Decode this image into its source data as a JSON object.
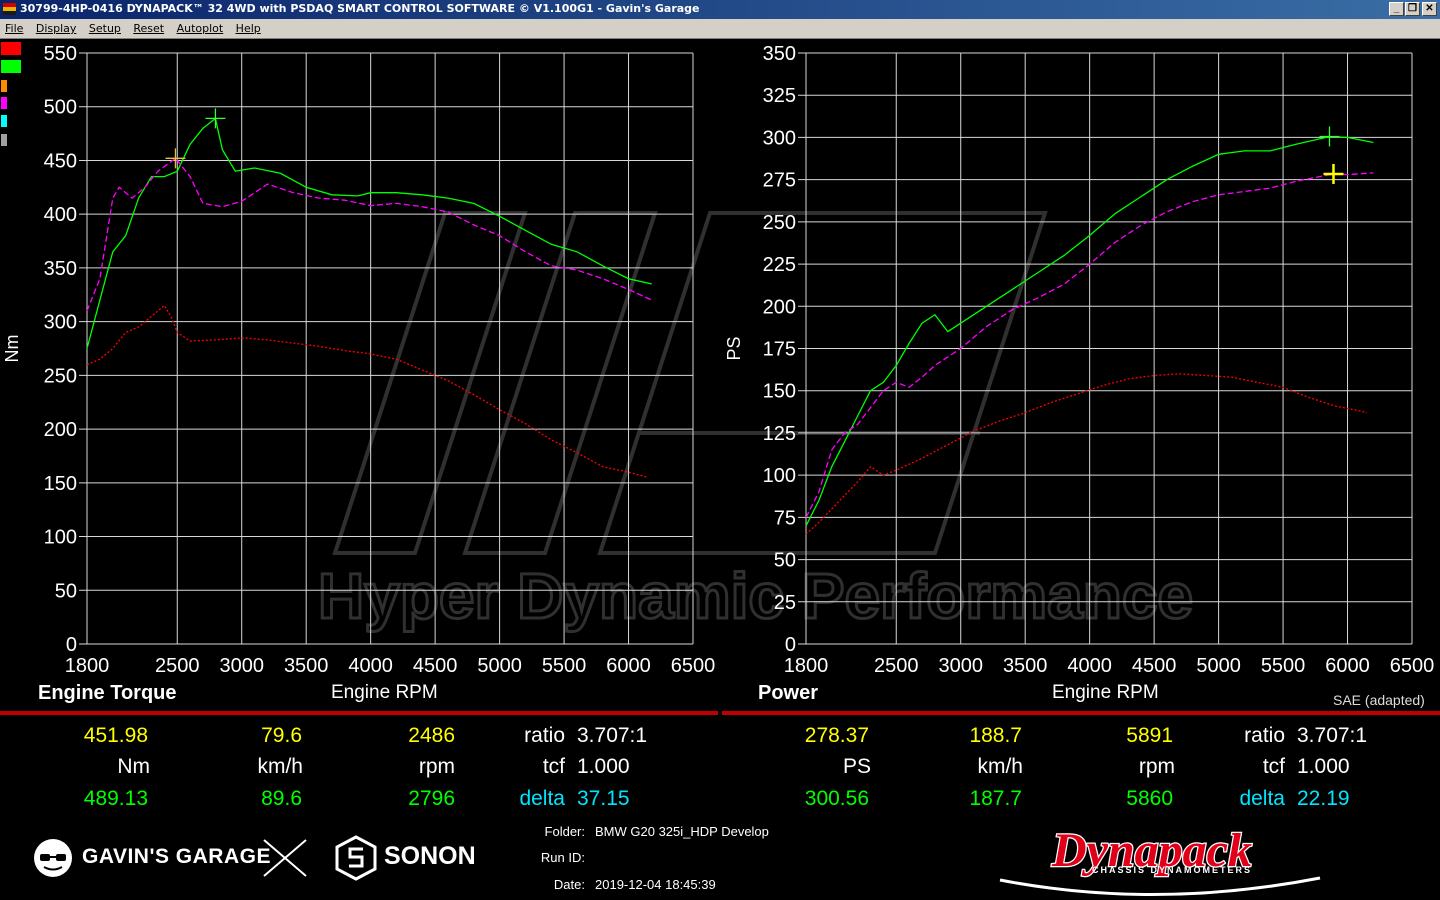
{
  "window": {
    "title": "30799-4HP-0416 DYNAPACK™ 32 4WD with PSDAQ SMART CONTROL SOFTWARE © V1.100G1 - Gavin's Garage",
    "buttons": [
      "_",
      "❐",
      "✕"
    ]
  },
  "menu": [
    "File",
    "Display",
    "Setup",
    "Reset",
    "Autoplot",
    "Help"
  ],
  "legend_colors": [
    "#ff0000",
    "#00ff00",
    "#ff8c00",
    "#ff00ff",
    "#00ffff",
    "#a0a0a0"
  ],
  "watermark": "Hyper Dynamic Performance",
  "chart_data": [
    {
      "type": "line",
      "title": "Engine Torque",
      "xlabel": "Engine RPM",
      "ylabel": "Nm",
      "xlim": [
        1800,
        6500
      ],
      "ylim": [
        0,
        550
      ],
      "xticks": [
        1800,
        2500,
        3000,
        3500,
        4000,
        4500,
        5000,
        5500,
        6000,
        6500
      ],
      "yticks": [
        0,
        50,
        100,
        150,
        200,
        250,
        300,
        350,
        400,
        450,
        500,
        550
      ],
      "grid": true,
      "series": [
        {
          "color": "#00ff00",
          "style": "solid",
          "points": [
            [
              1800,
              275
            ],
            [
              1900,
              320
            ],
            [
              2000,
              365
            ],
            [
              2100,
              380
            ],
            [
              2200,
              415
            ],
            [
              2300,
              435
            ],
            [
              2400,
              435
            ],
            [
              2500,
              440
            ],
            [
              2600,
              465
            ],
            [
              2700,
              480
            ],
            [
              2796,
              489
            ],
            [
              2850,
              460
            ],
            [
              2950,
              440
            ],
            [
              3100,
              443
            ],
            [
              3300,
              438
            ],
            [
              3500,
              425
            ],
            [
              3700,
              418
            ],
            [
              3900,
              417
            ],
            [
              4000,
              420
            ],
            [
              4200,
              420
            ],
            [
              4400,
              418
            ],
            [
              4600,
              415
            ],
            [
              4800,
              410
            ],
            [
              5000,
              398
            ],
            [
              5200,
              385
            ],
            [
              5400,
              372
            ],
            [
              5600,
              365
            ],
            [
              5800,
              352
            ],
            [
              6000,
              340
            ],
            [
              6180,
              335
            ]
          ]
        },
        {
          "color": "#ff00ff",
          "style": "dashed",
          "points": [
            [
              1800,
              310
            ],
            [
              1900,
              340
            ],
            [
              2000,
              415
            ],
            [
              2050,
              425
            ],
            [
              2150,
              415
            ],
            [
              2250,
              425
            ],
            [
              2350,
              440
            ],
            [
              2486,
              452
            ],
            [
              2600,
              435
            ],
            [
              2700,
              410
            ],
            [
              2850,
              407
            ],
            [
              3000,
              412
            ],
            [
              3200,
              428
            ],
            [
              3400,
              420
            ],
            [
              3600,
              415
            ],
            [
              3800,
              413
            ],
            [
              4000,
              408
            ],
            [
              4200,
              410
            ],
            [
              4400,
              407
            ],
            [
              4600,
              402
            ],
            [
              4800,
              390
            ],
            [
              5000,
              380
            ],
            [
              5200,
              365
            ],
            [
              5400,
              352
            ],
            [
              5600,
              348
            ],
            [
              5800,
              340
            ],
            [
              6000,
              330
            ],
            [
              6180,
              320
            ]
          ]
        },
        {
          "color": "#ff0000",
          "style": "dotted",
          "points": [
            [
              1800,
              260
            ],
            [
              1900,
              265
            ],
            [
              2000,
              275
            ],
            [
              2100,
              290
            ],
            [
              2200,
              295
            ],
            [
              2300,
              305
            ],
            [
              2400,
              315
            ],
            [
              2450,
              305
            ],
            [
              2500,
              290
            ],
            [
              2600,
              282
            ],
            [
              2800,
              283
            ],
            [
              3000,
              285
            ],
            [
              3200,
              283
            ],
            [
              3400,
              280
            ],
            [
              3600,
              277
            ],
            [
              3800,
              273
            ],
            [
              4000,
              270
            ],
            [
              4200,
              265
            ],
            [
              4400,
              255
            ],
            [
              4600,
              245
            ],
            [
              4800,
              232
            ],
            [
              5000,
              218
            ],
            [
              5200,
              205
            ],
            [
              5400,
              190
            ],
            [
              5600,
              178
            ],
            [
              5800,
              165
            ],
            [
              6000,
              160
            ],
            [
              6150,
              155
            ]
          ]
        }
      ]
    },
    {
      "type": "line",
      "title": "Power",
      "xlabel": "Engine RPM",
      "ylabel": "PS",
      "note": "SAE (adapted)",
      "xlim": [
        1800,
        6500
      ],
      "ylim": [
        0,
        350
      ],
      "xticks": [
        1800,
        2500,
        3000,
        3500,
        4000,
        4500,
        5000,
        5500,
        6000,
        6500
      ],
      "yticks": [
        0,
        25,
        50,
        75,
        100,
        125,
        150,
        175,
        200,
        225,
        250,
        275,
        300,
        325,
        350
      ],
      "grid": true,
      "series": [
        {
          "color": "#00ff00",
          "style": "solid",
          "points": [
            [
              1800,
              70
            ],
            [
              1900,
              85
            ],
            [
              2000,
              105
            ],
            [
              2100,
              120
            ],
            [
              2200,
              135
            ],
            [
              2300,
              150
            ],
            [
              2400,
              155
            ],
            [
              2500,
              165
            ],
            [
              2600,
              178
            ],
            [
              2700,
              190
            ],
            [
              2800,
              195
            ],
            [
              2900,
              185
            ],
            [
              3000,
              190
            ],
            [
              3200,
              200
            ],
            [
              3400,
              210
            ],
            [
              3600,
              220
            ],
            [
              3800,
              230
            ],
            [
              4000,
              242
            ],
            [
              4200,
              255
            ],
            [
              4400,
              265
            ],
            [
              4600,
              275
            ],
            [
              4800,
              283
            ],
            [
              5000,
              290
            ],
            [
              5200,
              292
            ],
            [
              5400,
              292
            ],
            [
              5600,
              296
            ],
            [
              5860,
              300.5
            ],
            [
              6000,
              300
            ],
            [
              6200,
              297
            ]
          ]
        },
        {
          "color": "#ff00ff",
          "style": "dashed",
          "points": [
            [
              1800,
              75
            ],
            [
              1900,
              90
            ],
            [
              2000,
              115
            ],
            [
              2100,
              125
            ],
            [
              2200,
              130
            ],
            [
              2300,
              140
            ],
            [
              2400,
              150
            ],
            [
              2500,
              155
            ],
            [
              2600,
              152
            ],
            [
              2700,
              158
            ],
            [
              2800,
              165
            ],
            [
              3000,
              175
            ],
            [
              3200,
              188
            ],
            [
              3400,
              198
            ],
            [
              3600,
              205
            ],
            [
              3800,
              213
            ],
            [
              4000,
              225
            ],
            [
              4200,
              238
            ],
            [
              4400,
              248
            ],
            [
              4600,
              256
            ],
            [
              4800,
              262
            ],
            [
              5000,
              266
            ],
            [
              5200,
              268
            ],
            [
              5400,
              270
            ],
            [
              5600,
              274
            ],
            [
              5891,
              278.4
            ],
            [
              6000,
              278
            ],
            [
              6200,
              279
            ]
          ]
        },
        {
          "color": "#ff0000",
          "style": "dotted",
          "points": [
            [
              1800,
              65
            ],
            [
              1900,
              72
            ],
            [
              2000,
              80
            ],
            [
              2100,
              88
            ],
            [
              2200,
              96
            ],
            [
              2300,
              105
            ],
            [
              2400,
              100
            ],
            [
              2500,
              103
            ],
            [
              2700,
              110
            ],
            [
              2900,
              118
            ],
            [
              3100,
              126
            ],
            [
              3300,
              132
            ],
            [
              3500,
              137
            ],
            [
              3700,
              143
            ],
            [
              3900,
              148
            ],
            [
              4100,
              153
            ],
            [
              4300,
              157
            ],
            [
              4500,
              159
            ],
            [
              4700,
              160
            ],
            [
              4900,
              159
            ],
            [
              5100,
              158
            ],
            [
              5300,
              155
            ],
            [
              5500,
              152
            ],
            [
              5700,
              146
            ],
            [
              5900,
              141
            ],
            [
              6100,
              138
            ],
            [
              6150,
              137
            ]
          ]
        }
      ]
    }
  ],
  "readouts": {
    "torque": {
      "row1": [
        "451.98",
        "79.6",
        "2486"
      ],
      "row2": [
        "Nm",
        "km/h",
        "rpm"
      ],
      "row3": [
        "489.13",
        "89.6",
        "2796"
      ],
      "ratio_label": "ratio",
      "ratio_value": "3.707:1",
      "tcf_label": "tcf",
      "tcf_value": "1.000",
      "delta_label": "delta",
      "delta_value": "37.15"
    },
    "power": {
      "row1": [
        "278.37",
        "188.7",
        "5891"
      ],
      "row2": [
        "PS",
        "km/h",
        "rpm"
      ],
      "row3": [
        "300.56",
        "187.7",
        "5860"
      ],
      "ratio_label": "ratio",
      "ratio_value": "3.707:1",
      "tcf_label": "tcf",
      "tcf_value": "1.000",
      "delta_label": "delta",
      "delta_value": "22.19"
    }
  },
  "info": {
    "folder_label": "Folder:",
    "folder_value": "BMW G20 325i_HDP Develop",
    "runid_label": "Run ID:",
    "runid_value": "",
    "date_label": "Date:",
    "date_value": "2019-12-04 18:45:39"
  },
  "brands": {
    "garage": "GAVIN'S GARAGE",
    "sonon": "SONON",
    "dynapack": "Dynapack",
    "dynapack_sub": "CHASSIS DYNAMOMETERS"
  }
}
